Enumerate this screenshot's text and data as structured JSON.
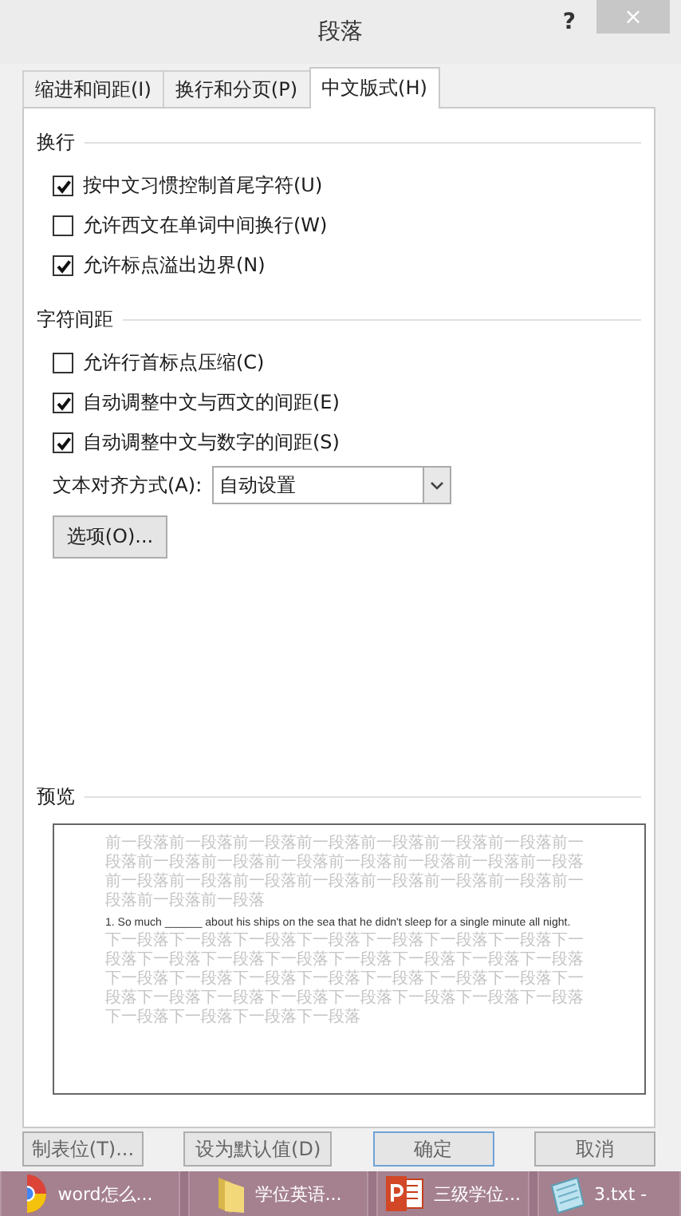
{
  "window": {
    "title": "段落",
    "help": "?",
    "close": "×"
  },
  "tabs": [
    {
      "label": "缩进和间距(I)",
      "selected": false
    },
    {
      "label": "换行和分页(P)",
      "selected": false
    },
    {
      "label": "中文版式(H)",
      "selected": true
    }
  ],
  "sections": [
    {
      "title": "换行",
      "options": [
        {
          "label": "按中文习惯控制首尾字符(U)",
          "checked": true
        },
        {
          "label": "允许西文在单词中间换行(W)",
          "checked": false
        },
        {
          "label": "允许标点溢出边界(N)",
          "checked": true
        }
      ]
    },
    {
      "title": "字符间距",
      "options": [
        {
          "label": "允许行首标点压缩(C)",
          "checked": false
        },
        {
          "label": "自动调整中文与西文的间距(E)",
          "checked": true
        },
        {
          "label": "自动调整中文与数字的间距(S)",
          "checked": true
        }
      ]
    }
  ],
  "alignment": {
    "label": "文本对齐方式(A):",
    "value": "自动设置"
  },
  "options_button": "选项(O)...",
  "preview": {
    "title": "预览",
    "before": "前一段落前一段落前一段落前一段落前一段落前一段落前一段落前一段落前一段落前一段落前一段落前一段落前一段落前一段落前一段落前一段落前一段落前一段落前一段落前一段落前一段落前一段落前一段落前一段落前一段落",
    "sample": "1. So much ______ about his ships on the sea that he didn't sleep for a single minute all night.",
    "after": "下一段落下一段落下一段落下一段落下一段落下一段落下一段落下一段落下一段落下一段落下一段落下一段落下一段落下一段落下一段落下一段落下一段落下一段落下一段落下一段落下一段落下一段落下一段落下一段落下一段落下一段落下一段落下一段落下一段落下一段落下一段落下一段落下一段落下一段落"
  },
  "buttons": [
    {
      "label": "制表位(T)...",
      "default": false
    },
    {
      "label": "设为默认值(D)",
      "default": false
    },
    {
      "label": "确定",
      "default": true
    },
    {
      "label": "取消",
      "default": false
    }
  ],
  "taskbar": [
    {
      "kind": "browser",
      "label": "word怎么..."
    },
    {
      "kind": "folder",
      "label": "学位英语..."
    },
    {
      "kind": "slides",
      "label": "三级学位..."
    },
    {
      "kind": "notepad",
      "label": "3.txt - "
    }
  ]
}
